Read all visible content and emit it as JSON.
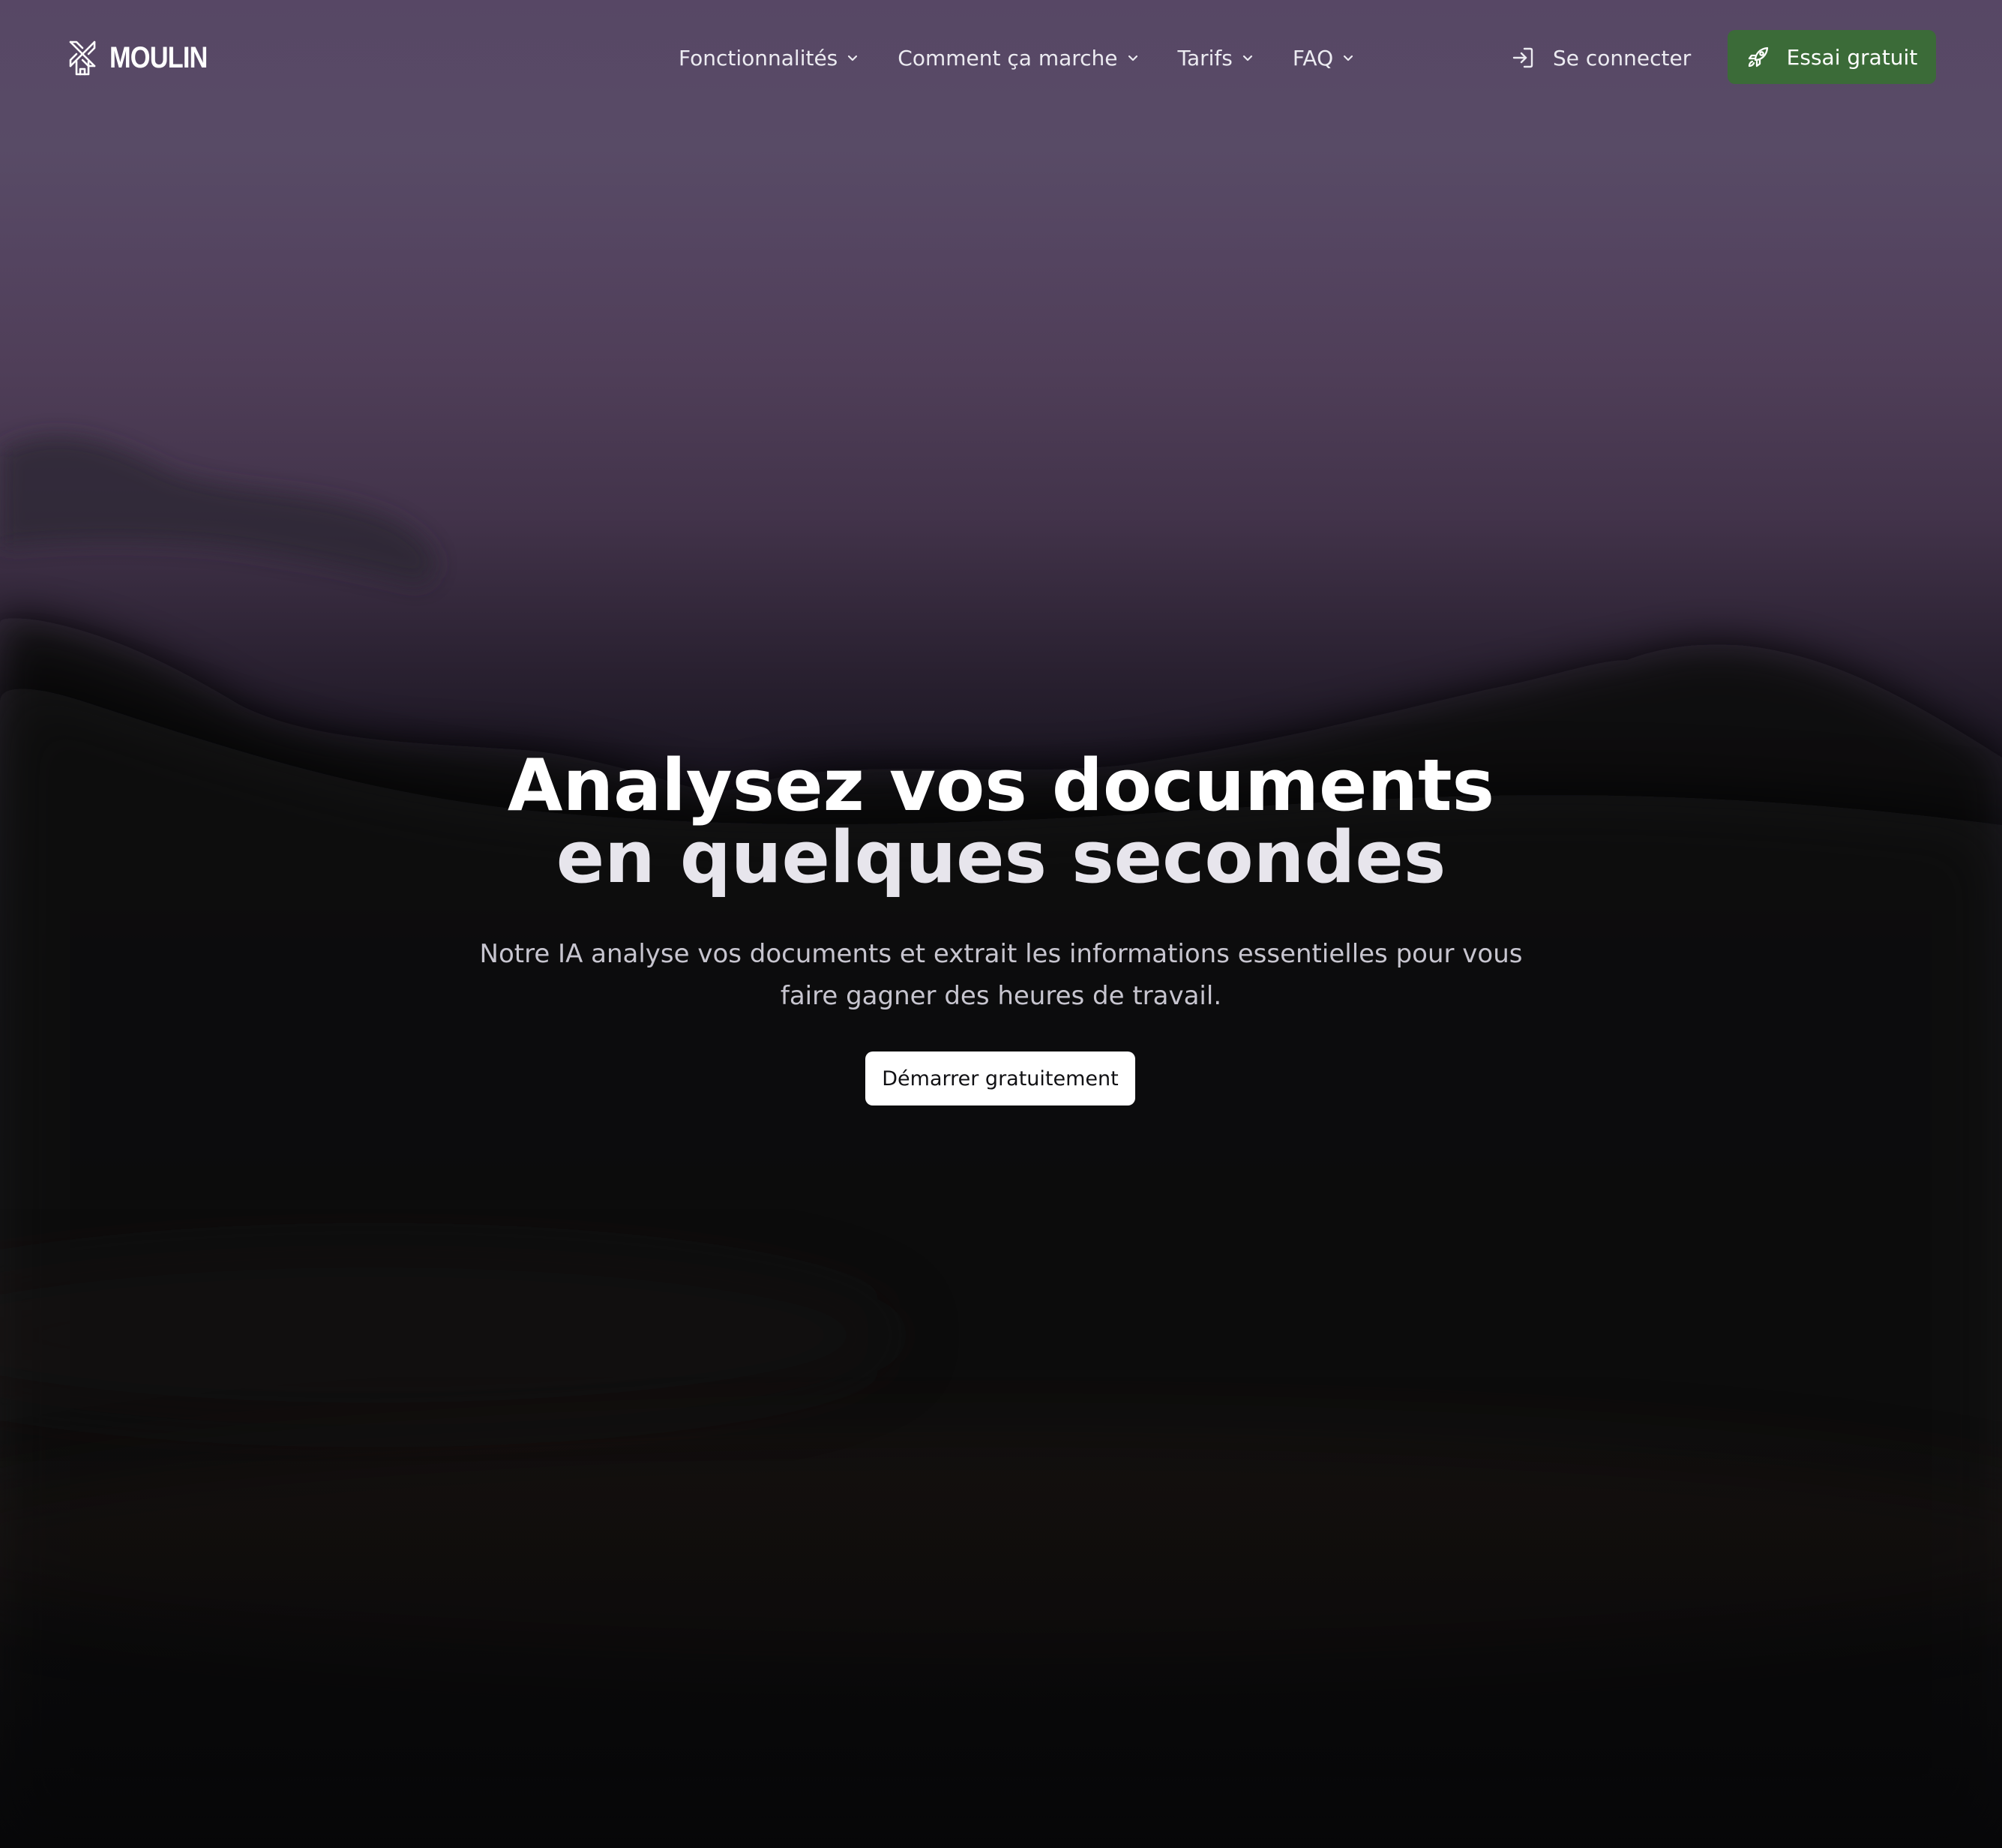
{
  "brand": {
    "name": "MOULIN",
    "icon": "windmill-icon"
  },
  "nav": {
    "items": [
      {
        "label": "Fonctionnalités",
        "icon": "chevron-down-icon"
      },
      {
        "label": "Comment ça marche",
        "icon": "chevron-down-icon"
      },
      {
        "label": "Tarifs",
        "icon": "chevron-down-icon"
      },
      {
        "label": "FAQ",
        "icon": "chevron-down-icon"
      }
    ],
    "login": {
      "label": "Se connecter",
      "icon": "sign-in-icon"
    },
    "cta": {
      "label": "Essai gratuit",
      "icon": "rocket-icon",
      "color": "#3b6b38"
    }
  },
  "hero": {
    "title_line1": "Analysez vos documents",
    "title_line2": "en quelques secondes",
    "subtitle": "Notre IA analyse vos documents et extrait les informations essentielles pour vous faire gagner des heures de travail.",
    "cta_label": "Démarrer gratuitement"
  },
  "colors": {
    "sky_top": "#574765",
    "background_bottom": "#07070b",
    "cta_green": "#3b6b38",
    "cta_white": "#ffffff"
  }
}
